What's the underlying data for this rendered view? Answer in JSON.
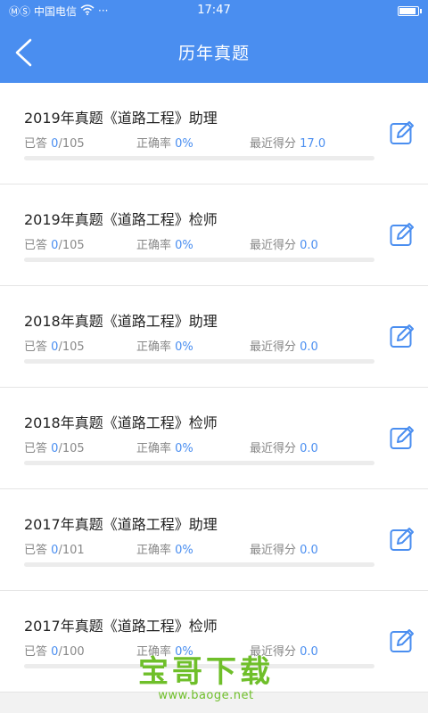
{
  "status_bar": {
    "carrier": "中国电信",
    "signal_text": "ⓂⓈ",
    "dots": "···",
    "time": "17:47"
  },
  "header": {
    "title": "历年真题"
  },
  "colors": {
    "header_bg": "#4a8ef0",
    "accent": "#4a8ef0",
    "watermark": "#6fbf2a"
  },
  "labels": {
    "answered": "已答",
    "accuracy": "正确率",
    "recent_score": "最近得分"
  },
  "items": [
    {
      "title": "2019年真题《道路工程》助理",
      "answered": "0",
      "total": "/105",
      "accuracy": "0%",
      "score": "17.0",
      "progress": 0
    },
    {
      "title": "2019年真题《道路工程》检师",
      "answered": "0",
      "total": "/105",
      "accuracy": "0%",
      "score": "0.0",
      "progress": 0
    },
    {
      "title": "2018年真题《道路工程》助理",
      "answered": "0",
      "total": "/105",
      "accuracy": "0%",
      "score": "0.0",
      "progress": 0
    },
    {
      "title": "2018年真题《道路工程》检师",
      "answered": "0",
      "total": "/105",
      "accuracy": "0%",
      "score": "0.0",
      "progress": 0
    },
    {
      "title": "2017年真题《道路工程》助理",
      "answered": "0",
      "total": "/101",
      "accuracy": "0%",
      "score": "0.0",
      "progress": 0
    },
    {
      "title": "2017年真题《道路工程》检师",
      "answered": "0",
      "total": "/100",
      "accuracy": "0%",
      "score": "0.0",
      "progress": 0
    }
  ],
  "watermark": {
    "brand": "宝哥下载",
    "url": "www.baoge.net"
  }
}
